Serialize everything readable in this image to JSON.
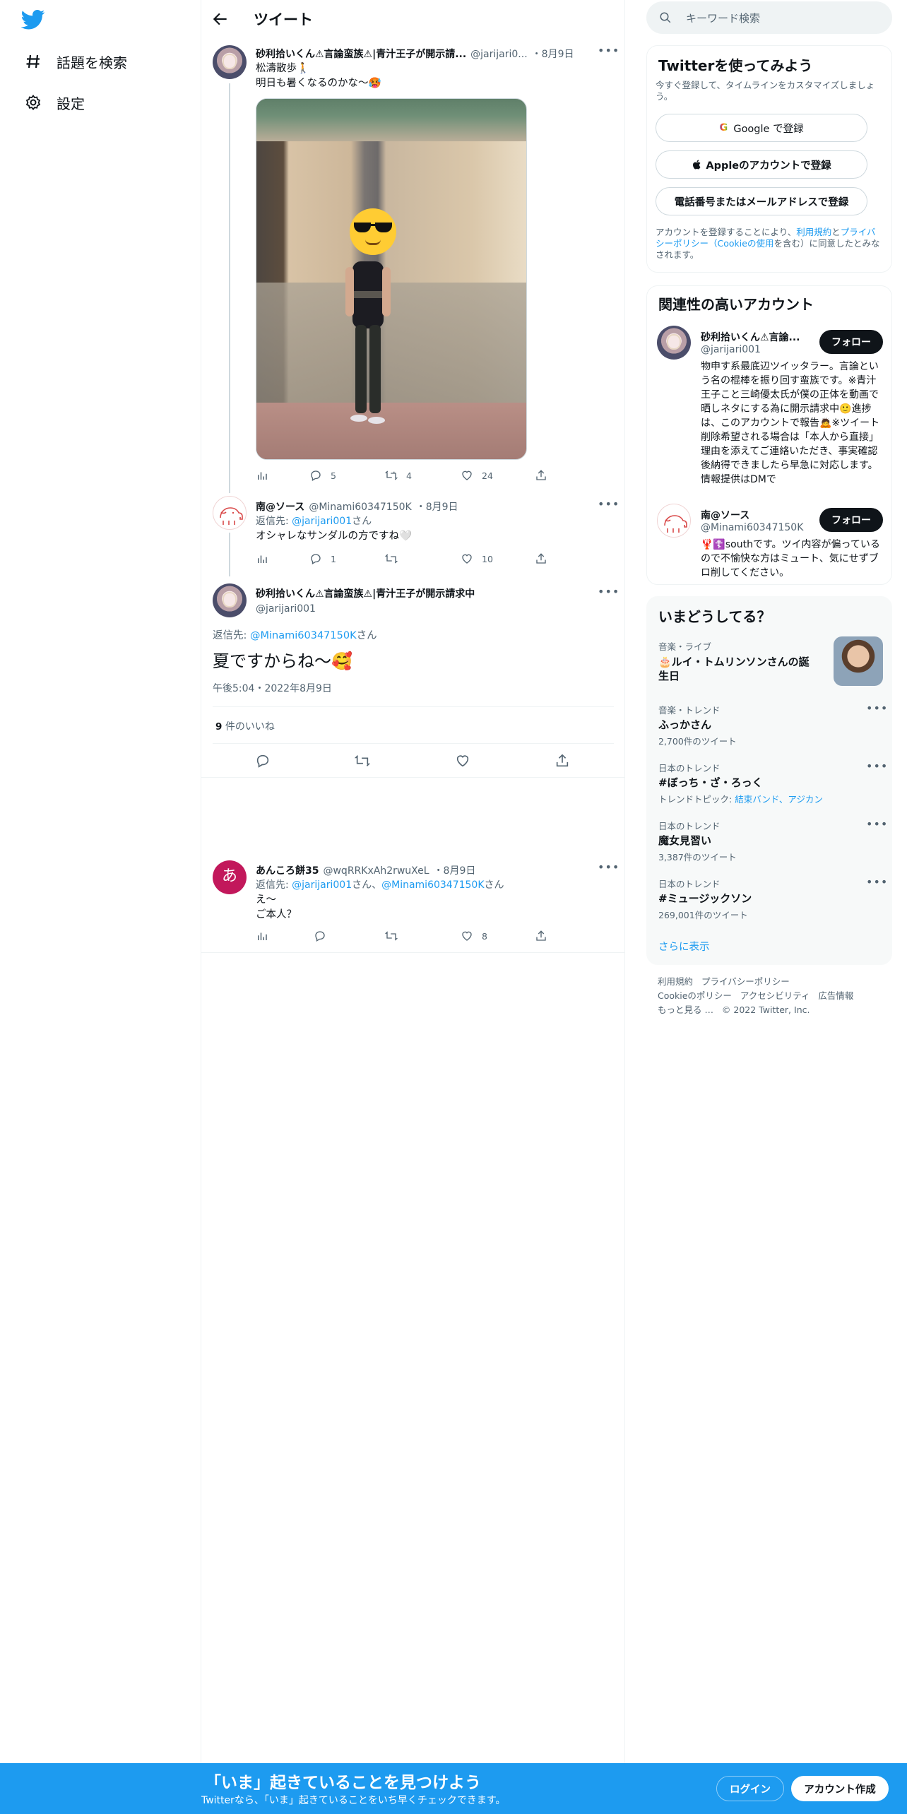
{
  "colors": {
    "accent": "#1d9bf0",
    "text": "#0f1419",
    "muted": "#536471",
    "border": "#eff3f4"
  },
  "leftnav": {
    "logo_icon": "twitter-bird-icon",
    "items": [
      {
        "label": "話題を検索",
        "icon": "hashtag-icon"
      },
      {
        "label": "設定",
        "icon": "gear-icon"
      }
    ]
  },
  "header": {
    "title": "ツイート",
    "back_icon": "arrow-left-icon"
  },
  "tweet1": {
    "name": "砂利拾いくん⚠言論蛮族⚠|青汁王子が開示請...",
    "handle": "@jarijari0...",
    "date": "・8月9日",
    "text_line1": "松濤散歩🚶",
    "text_line2": "明日も暑くなるのかな〜🥵",
    "views_icon": "chart-icon",
    "replies": "5",
    "retweets": "4",
    "likes": "24"
  },
  "tweet2": {
    "name": "南@ソース",
    "handle": "@Minami60347150K",
    "date": "・8月9日",
    "reply_prefix": "返信先: ",
    "reply_to": "@jarijari001",
    "reply_suffix": "さん",
    "text": "オシャレなサンダルの方ですね🤍",
    "replies": "1",
    "retweets": "",
    "likes": "10"
  },
  "main_tweet": {
    "name": "砂利拾いくん⚠言論蛮族⚠|青汁王子が開示請求中",
    "handle": "@jarijari001",
    "reply_prefix": "返信先: ",
    "reply_to": "@Minami60347150K",
    "reply_suffix": "さん",
    "text": "夏ですからね〜🥰",
    "timestamp": "午後5:04・2022年8月9日",
    "like_count": "9",
    "like_label": " 件のいいね"
  },
  "tweet3": {
    "name": "あんころ餅35",
    "handle": "@wqRRKxAh2rwuXeL",
    "date": "・8月9日",
    "reply_prefix": "返信先: ",
    "reply_to1": "@jarijari001",
    "reply_mid": "さん、",
    "reply_to2": "@Minami60347150K",
    "reply_suffix": "さん",
    "text_line1": "え〜",
    "text_line2": "ご本人？",
    "likes": "8"
  },
  "search": {
    "placeholder": "キーワード検索"
  },
  "signup_card": {
    "title": "Twitterを使ってみよう",
    "desc": "今すぐ登録して、タイムラインをカスタマイズしましょう。",
    "google": "Google で登録",
    "apple": "Appleのアカウントで登録",
    "phone": "電話番号またはメールアドレスで登録",
    "terms_pre": "アカウントを登録することにより、",
    "terms_link1": "利用規約",
    "terms_and": "と",
    "terms_link2": "プライバシーポリシー",
    "terms_paren_open": "（",
    "terms_link3": "Cookieの使用",
    "terms_post": "を含む）に同意したとみなされます。"
  },
  "related": {
    "title": "関連性の高いアカウント",
    "accounts": [
      {
        "name": "砂利拾いくん⚠言論...",
        "handle": "@jarijari001",
        "follow": "フォロー",
        "bio": "物申す系最底辺ツイッタラー。言論という名の棍棒を振り回す蛮族です。※青汁王子こと三崎優太氏が僕の正体を動画で晒しネタにする為に開示請求中🙂進捗は、このアカウントで報告🙇※ツイート削除希望される場合は「本人から直接」理由を添えてご連絡いただき、事実確認後納得できましたら早急に対応します。情報提供はDMで"
      },
      {
        "name": "南@ソース",
        "handle": "@Minami60347150K",
        "follow": "フォロー",
        "bio": "🦞☦️southです。ツイ内容が偏っているので不愉快な方はミュート、気にせずブロ削してください。"
      }
    ]
  },
  "trends": {
    "title": "いまどうしてる？",
    "items": [
      {
        "category": "音楽・ライブ",
        "name": "🎂ルイ・トムリンソンさんの誕生日",
        "sub": ""
      },
      {
        "category": "音楽・トレンド",
        "name": "ふっかさん",
        "sub": "2,700件のツイート"
      },
      {
        "category": "日本のトレンド",
        "name": "#ぼっち・ざ・ろっく",
        "sub_pre": "トレンドトピック: ",
        "sub_links": "結束バンド、アジカン"
      },
      {
        "category": "日本のトレンド",
        "name": "魔女見習い",
        "sub": "3,387件のツイート"
      },
      {
        "category": "日本のトレンド",
        "name": "#ミュージックソン",
        "sub": "269,001件のツイート"
      }
    ],
    "show_more": "さらに表示"
  },
  "footer": {
    "terms": "利用規約",
    "privacy": "プライバシーポリシー",
    "cookie": "Cookieのポリシー",
    "accessibility": "アクセシビリティ",
    "ads": "広告情報",
    "more": "もっと見る …",
    "copyright": "© 2022 Twitter, Inc."
  },
  "bottombar": {
    "title": "「いま」起きていることを見つけよう",
    "subtitle": "Twitterなら、「いま」起きていることをいち早くチェックできます。",
    "login": "ログイン",
    "signup": "アカウント作成"
  }
}
